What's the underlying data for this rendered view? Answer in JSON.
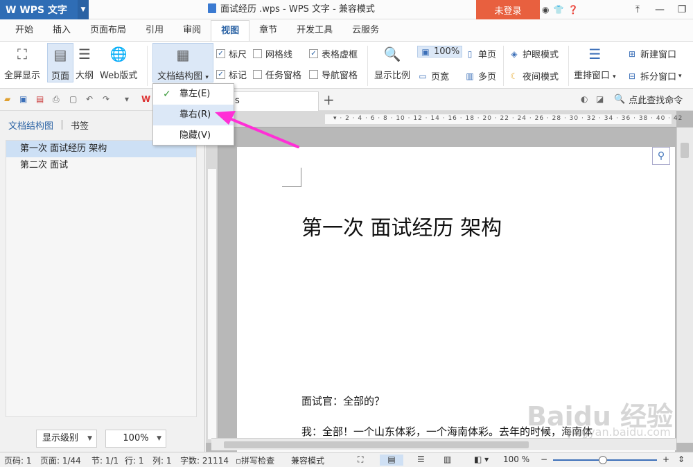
{
  "titlebar": {
    "app_name": "W WPS 文字",
    "document_title": "面试经历 .wps - WPS 文字 - 兼容模式",
    "login_label": "未登录"
  },
  "tabs": [
    "开始",
    "插入",
    "页面布局",
    "引用",
    "审阅",
    "视图",
    "章节",
    "开发工具",
    "云服务"
  ],
  "active_tab": "视图",
  "ribbon": {
    "fullscreen": "全屏显示",
    "page": "页面",
    "outline": "大纲",
    "web": "Web版式",
    "docmap": "文档结构图",
    "ruler": "标尺",
    "gridlines": "网格线",
    "table_frame": "表格虚框",
    "marks": "标记",
    "task_pane": "任务窗格",
    "nav_pane": "导航窗格",
    "zoom": "显示比例",
    "zoom_100": "100%",
    "single_page": "单页",
    "page_width": "页宽",
    "multi_page": "多页",
    "eye_mode": "护眼模式",
    "night_mode": "夜间模式",
    "arrange": "重排窗口",
    "new_window": "新建窗口",
    "split_window": "拆分窗口"
  },
  "docmap_menu": {
    "items": [
      "靠左(E)",
      "靠右(R)",
      "隐藏(V)"
    ],
    "checked_index": 0,
    "hover_index": 1
  },
  "quickbar": {
    "doc_tab_label": "s",
    "find_command": "点此查找命令"
  },
  "left_pane": {
    "tab_structure": "文档结构图",
    "tab_bookmark": "书签",
    "items": [
      "第一次   面试经历  架构",
      "第二次  面试"
    ],
    "level_label": "显示级别",
    "zoom_label": "100%"
  },
  "document": {
    "heading": "第一次   面试经历  架构",
    "para1": "面试官：全部的？",
    "para2": "我：全部！一个山东体彩，一个海南体彩。去年的时候，海南体"
  },
  "status": {
    "page_code": "页码: 1",
    "page": "页面: 1/44",
    "section": "节: 1/1",
    "line": "行: 1",
    "column": "列: 1",
    "words": "字数: 21114",
    "spell": "拼写检查",
    "compat": "兼容模式",
    "zoom": "100 %"
  },
  "watermark": {
    "brand": "Baidu 经验",
    "site": "jingyan.baidu.com"
  },
  "colors": {
    "accent": "#2f6db5",
    "login": "#e8603f",
    "annotation_arrow": "#ff2fd6"
  }
}
